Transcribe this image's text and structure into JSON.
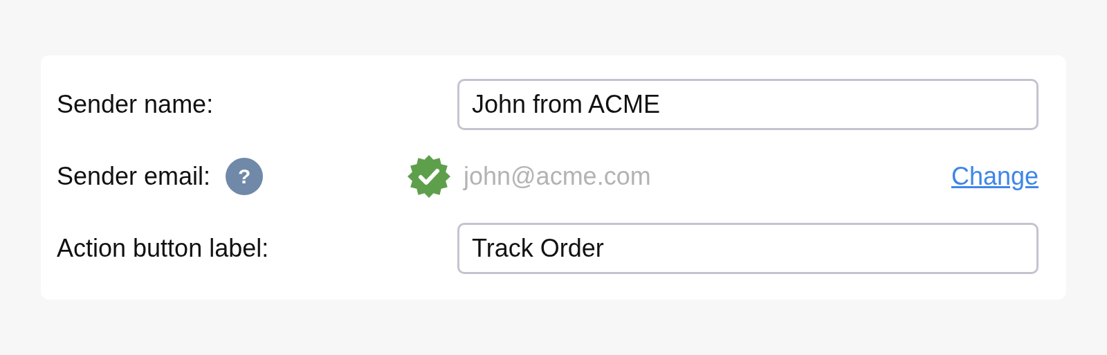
{
  "fields": [
    {
      "kind": "input",
      "label": "Sender name:",
      "value": "John from ACME"
    },
    {
      "kind": "email",
      "label": "Sender email:",
      "help": "?",
      "verified": true,
      "value": "john@acme.com",
      "action": "Change"
    },
    {
      "kind": "input",
      "label": "Action button label:",
      "value": "Track Order"
    }
  ]
}
